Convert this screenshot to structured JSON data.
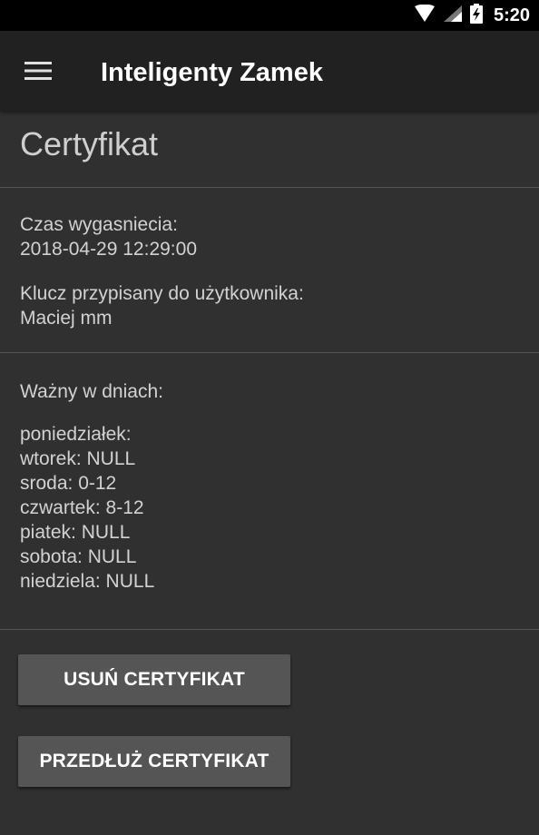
{
  "status_bar": {
    "time": "5:20",
    "icons": [
      "wifi-icon",
      "signal-icon",
      "battery-charging-icon"
    ]
  },
  "app_bar": {
    "title": "Inteligenty Zamek",
    "menu_icon": "hamburger-menu-icon"
  },
  "page": {
    "title": "Certyfikat"
  },
  "expiry": {
    "label": "Czas wygasniecia:",
    "value": "2018-04-29  12:29:00"
  },
  "owner": {
    "label": "Klucz przypisany do użytkownika:",
    "value": "Maciej mm"
  },
  "validity": {
    "label": "Ważny w dniach:",
    "days": [
      "poniedziałek:",
      "wtorek: NULL",
      "sroda: 0-12",
      "czwartek: 8-12",
      "piatek: NULL",
      "sobota: NULL",
      "niedziela: NULL"
    ]
  },
  "actions": {
    "delete_label": "USUŃ CERTYFIKAT",
    "extend_label": "PRZEDŁUŻ CERTYFIKAT"
  },
  "colors": {
    "background": "#303030",
    "app_bar": "#212121",
    "button": "#555555"
  }
}
